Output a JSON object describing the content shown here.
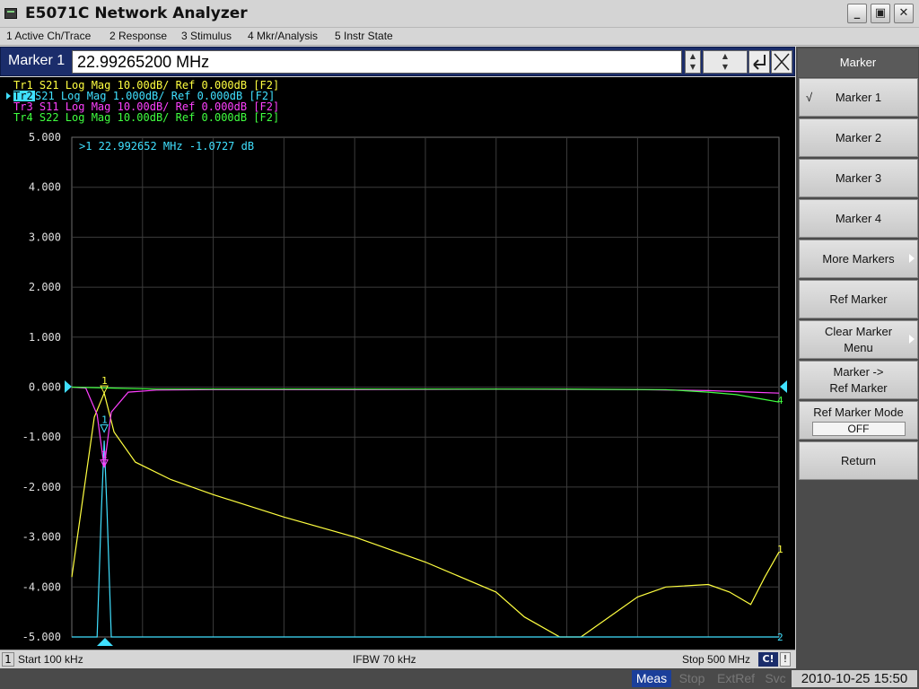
{
  "window": {
    "title": "E5071C Network Analyzer",
    "minimize": "_",
    "restore": "▣",
    "close": "✕"
  },
  "menu": {
    "items": [
      "1 Active Ch/Trace",
      "2 Response",
      "3 Stimulus",
      "4 Mkr/Analysis",
      "5 Instr State"
    ]
  },
  "entry": {
    "label": "Marker 1",
    "value": "22.99265200 MHz"
  },
  "traces": [
    {
      "text": "Tr1  S21 Log Mag 10.00dB/ Ref 0.000dB [F2]",
      "color": "#ffff40"
    },
    {
      "id": "Tr2",
      "text": " S21 Log Mag 1.000dB/ Ref 0.000dB [F2]",
      "color": "#40e0ff"
    },
    {
      "text": "Tr3  S11 Log Mag 10.00dB/ Ref 0.000dB [F2]",
      "color": "#ff40ff"
    },
    {
      "text": "Tr4  S22 Log Mag 10.00dB/ Ref 0.000dB [F2]",
      "color": "#40ff40"
    }
  ],
  "marker_readout": ">1  22.992652 MHz -1.0727 dB",
  "chart_data": {
    "type": "line",
    "ylim": [
      -5,
      5
    ],
    "yticks": [
      "5.000",
      "4.000",
      "3.000",
      "2.000",
      "1.000",
      "0.000",
      "-1.000",
      "-2.000",
      "-3.000",
      "-4.000",
      "-5.000"
    ],
    "xlim_mhz": [
      0.1,
      500
    ],
    "grid": true,
    "series": [
      {
        "name": "Tr1",
        "color": "#ffff40",
        "x": [
          0.1,
          8,
          16,
          22.99,
          30,
          45,
          70,
          100,
          150,
          200,
          250,
          300,
          320,
          345,
          360,
          400,
          420,
          450,
          465,
          480,
          490,
          500
        ],
        "y": [
          -3.8,
          -2.2,
          -0.6,
          -0.12,
          -0.9,
          -1.5,
          -1.85,
          -2.15,
          -2.6,
          -3.0,
          -3.5,
          -4.1,
          -4.6,
          -5.0,
          -5.0,
          -4.2,
          -4.0,
          -3.95,
          -4.1,
          -4.35,
          -3.8,
          -3.3
        ]
      },
      {
        "name": "Tr2",
        "color": "#40e0ff",
        "x": [
          0.1,
          18,
          21,
          22.99,
          25,
          28,
          500
        ],
        "y": [
          -5.0,
          -5.0,
          -2.5,
          -1.07,
          -2.5,
          -5.0,
          -5.0
        ]
      },
      {
        "name": "Tr3",
        "color": "#ff40ff",
        "x": [
          0.1,
          10,
          18,
          22.99,
          28,
          40,
          60,
          100,
          200,
          300,
          400,
          450,
          480,
          500
        ],
        "y": [
          0.0,
          -0.02,
          -0.55,
          -1.6,
          -0.5,
          -0.1,
          -0.06,
          -0.05,
          -0.05,
          -0.04,
          -0.05,
          -0.07,
          -0.1,
          -0.12
        ]
      },
      {
        "name": "Tr4",
        "color": "#40ff40",
        "x": [
          0.1,
          60,
          200,
          350,
          420,
          450,
          470,
          480,
          490,
          500
        ],
        "y": [
          0.0,
          -0.04,
          -0.04,
          -0.04,
          -0.05,
          -0.1,
          -0.15,
          -0.2,
          -0.25,
          -0.3
        ]
      }
    ],
    "markers": [
      {
        "label": "1",
        "x_mhz": 22.99,
        "y": -0.12,
        "color": "#ffff40"
      },
      {
        "label": "1",
        "x_mhz": 22.99,
        "y": -0.9,
        "color": "#40e0ff"
      },
      {
        "label": "1",
        "x_mhz": 22.99,
        "y": -1.6,
        "color": "#ff40ff"
      }
    ]
  },
  "status": {
    "channel": "1",
    "start": "Start 100 kHz",
    "ifbw": "IFBW 70 kHz",
    "stop": "Stop 500 MHz",
    "cal": "C!",
    "warn": "!"
  },
  "instrument": {
    "meas": "Meas",
    "stop": "Stop",
    "extref": "ExtRef",
    "svc": "Svc",
    "datetime": "2010-10-25 15:50"
  },
  "softkeys": {
    "header": "Marker",
    "items": [
      {
        "label": "Marker 1",
        "checked": "√"
      },
      {
        "label": "Marker 2"
      },
      {
        "label": "Marker 3"
      },
      {
        "label": "Marker 4"
      },
      {
        "label": "More Markers"
      },
      {
        "label": "Ref Marker"
      },
      {
        "label": "Clear Marker\nMenu"
      },
      {
        "label": "Marker ->\nRef Marker"
      },
      {
        "label": "Ref Marker Mode",
        "value": "OFF"
      },
      {
        "label": "Return"
      }
    ]
  }
}
